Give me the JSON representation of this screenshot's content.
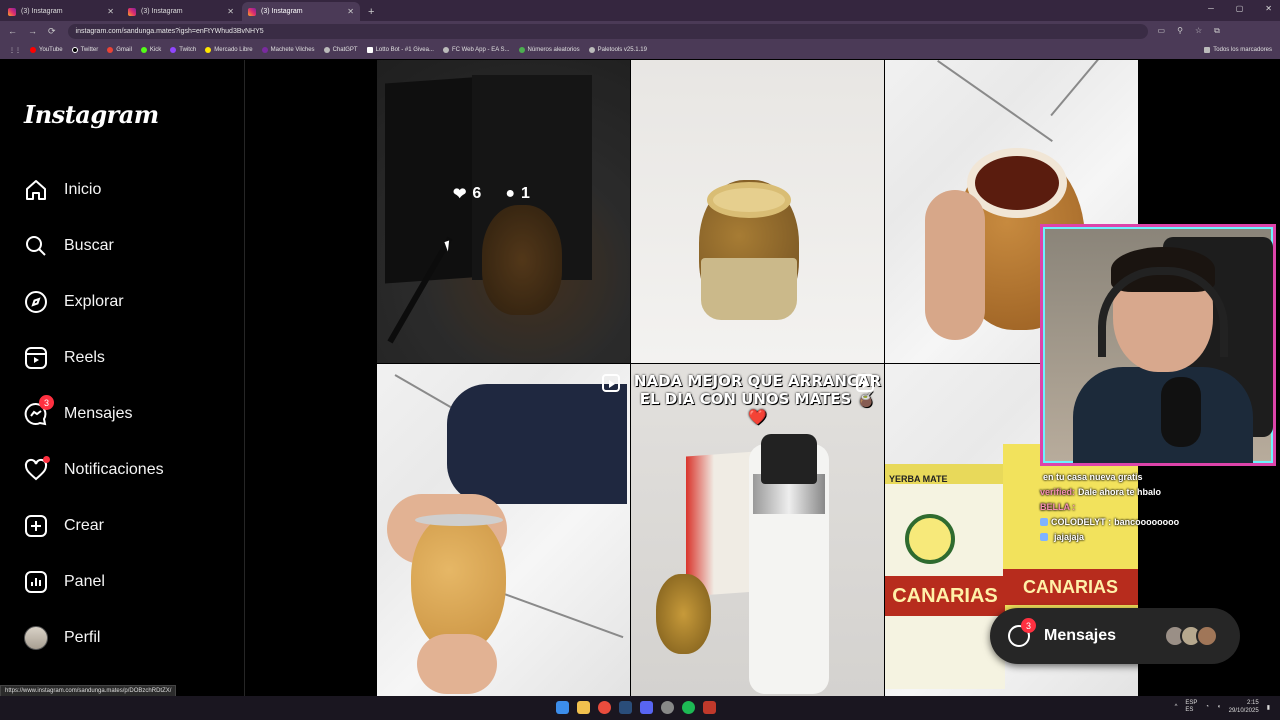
{
  "browser": {
    "tabs": [
      {
        "title": "(3) Instagram"
      },
      {
        "title": "(3) Instagram"
      },
      {
        "title": "(3) Instagram"
      }
    ],
    "url": "instagram.com/sandunga.mates?igsh=enFtYWhud3BvNHY5",
    "bookmarks": [
      "YouTube",
      "Twitter",
      "Gmail",
      "Kick",
      "Twitch",
      "Mercado Libre",
      "Machete Vilches",
      "ChatGPT",
      "Lotto Bot - #1 Givea...",
      "FC Web App - EA S...",
      "Números aleatorios",
      "Paletools v25.1.19"
    ],
    "bookmarks_right": "Todos los marcadores"
  },
  "sidebar": {
    "logo": "Instagram",
    "items": [
      {
        "label": "Inicio",
        "icon": "home-icon"
      },
      {
        "label": "Buscar",
        "icon": "search-icon"
      },
      {
        "label": "Explorar",
        "icon": "compass-icon"
      },
      {
        "label": "Reels",
        "icon": "reels-icon"
      },
      {
        "label": "Mensajes",
        "icon": "messenger-icon",
        "badge": "3"
      },
      {
        "label": "Notificaciones",
        "icon": "heart-icon"
      },
      {
        "label": "Crear",
        "icon": "plus-square-icon"
      },
      {
        "label": "Panel",
        "icon": "chart-icon"
      },
      {
        "label": "Perfil",
        "icon": "avatar"
      }
    ]
  },
  "grid": {
    "hover_likes": "6",
    "hover_comments": "1",
    "post5_caption": "NADA MEJOR QUE ARRANCAR EL DIA CON UNOS MATES 🧉❤️",
    "pack_brand": "CANARIAS",
    "pack_label": "YERBA MATE"
  },
  "chat": [
    {
      "user": "",
      "text": "en tu casa nueva gratis"
    },
    {
      "user": "verified:",
      "text": "Dale ahora te hbalo"
    },
    {
      "user": "BELLA :",
      "text": ""
    },
    {
      "user": "COLODELYT :",
      "text": "bancoooooooo"
    },
    {
      "user": "",
      "text": "jajajaja"
    }
  ],
  "messages_pill": {
    "label": "Mensajes",
    "badge": "3"
  },
  "status_url": "https://www.instagram.com/sandunga.mates/p/DOBzchRDtZX/",
  "taskbar": {
    "lang": "ESP\nES",
    "time": "2:15",
    "date": "29/10/2025"
  }
}
